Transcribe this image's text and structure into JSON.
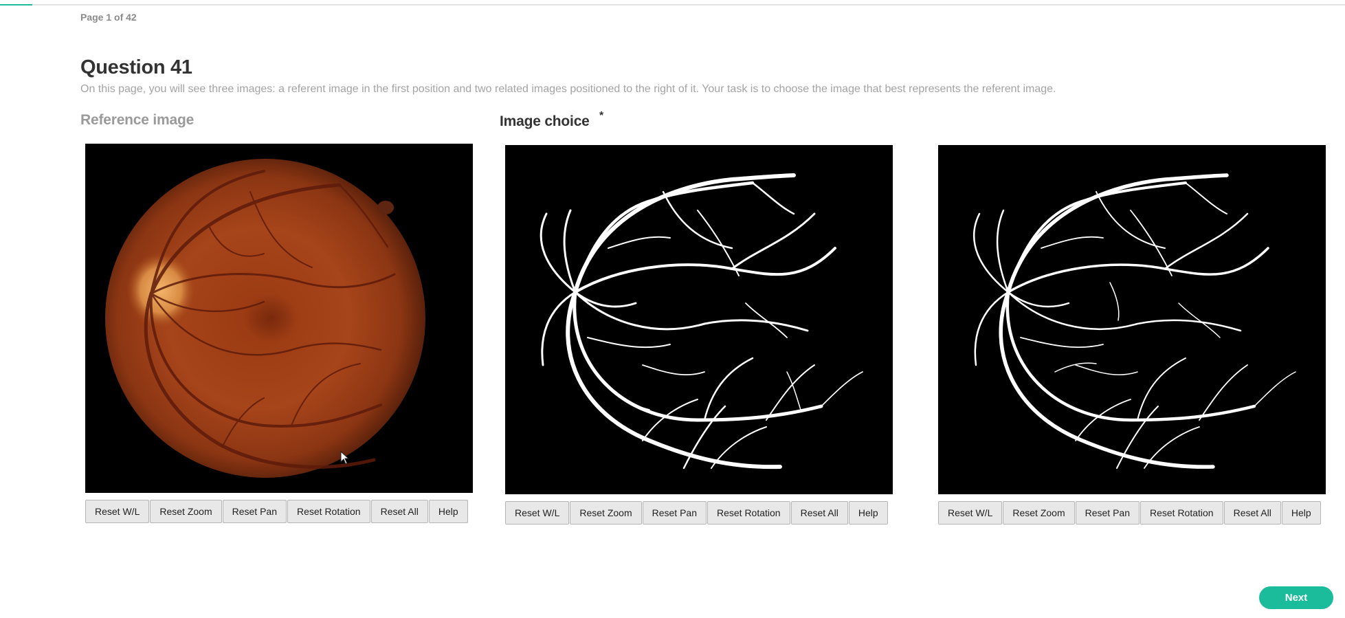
{
  "progress": {
    "fraction": 0.024
  },
  "header": {
    "page_indicator": "Page 1 of 42"
  },
  "question": {
    "title": "Question 41",
    "description": "On this page, you will see three images: a referent image in the first position and two related images positioned to the right of it. Your task is to choose the image that best represents the referent image."
  },
  "reference": {
    "label": "Reference image"
  },
  "choice": {
    "label": "Image choice",
    "required_mark": "*"
  },
  "viewer_buttons": {
    "reset_wl": "Reset W/L",
    "reset_zoom": "Reset Zoom",
    "reset_pan": "Reset Pan",
    "reset_rotation": "Reset Rotation",
    "reset_all": "Reset All",
    "help": "Help"
  },
  "navigation": {
    "next_label": "Next"
  },
  "colors": {
    "accent": "#1abc9c",
    "viewer_bg": "#000000"
  },
  "icons": {
    "pointer": "mouse-pointer-icon"
  }
}
